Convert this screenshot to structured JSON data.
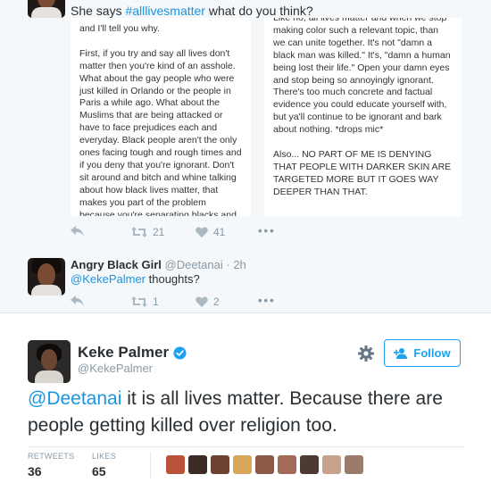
{
  "tweet1": {
    "text_prefix": "She says ",
    "hashtag": "#alllivesmatter",
    "text_suffix": " what do you think?",
    "image_left_text": "and I'll tell you why.\n\nFirst, if you try and say all lives don't matter then you're kind of an asshole. What about the gay people who were just killed in Orlando or the people in Paris a while ago. What about the Muslims that are being attacked or have to face prejudices each and everyday. Black people aren't the only ones facing tough and rough times and if you deny that you're ignorant. Don't sit around and bitch and whine talking about how black lives matter, that makes you part of the problem because you're separating blacks and whites just like",
    "image_right_text": "Like no, all lives matter and when we stop making color such a relevant topic, than we can unite together. It's not \"damn a black man was killed.\" It's, \"damn a human being lost their life.\" Open your damn eyes and stop being so annoyingly ignorant. There's too much concrete and factual evidence you could educate yourself with, but ya'll continue to be ignorant and bark about nothing. *drops mic*\n\nAlso... NO PART OF ME IS DENYING THAT PEOPLE WITH DARKER SKIN ARE TARGETED MORE BUT IT GOES WAY DEEPER THAN THAT.",
    "retweets": "21",
    "likes": "41"
  },
  "tweet2": {
    "name": "Angry Black Girl",
    "handle": "@Deetanai",
    "time": "2h",
    "mention": "@KekePalmer",
    "text": " thoughts?",
    "retweets": "1",
    "likes": "2"
  },
  "main_tweet": {
    "name": "Keke Palmer",
    "handle": "@KekePalmer",
    "follow_label": "Follow",
    "mention": "@Deetanai",
    "text": " it is all lives matter. Because there are people getting killed over religion too.",
    "retweets_label": "RETWEETS",
    "retweets": "36",
    "likes_label": "LIKES",
    "likes": "65"
  },
  "colors": {
    "link": "#1b95e0",
    "follow": "#1da1f2",
    "muted": "#8899a6"
  },
  "icons": [
    "reply-icon",
    "retweet-icon",
    "like-icon",
    "more-icon",
    "verified-icon",
    "gear-icon",
    "add-user-icon"
  ]
}
